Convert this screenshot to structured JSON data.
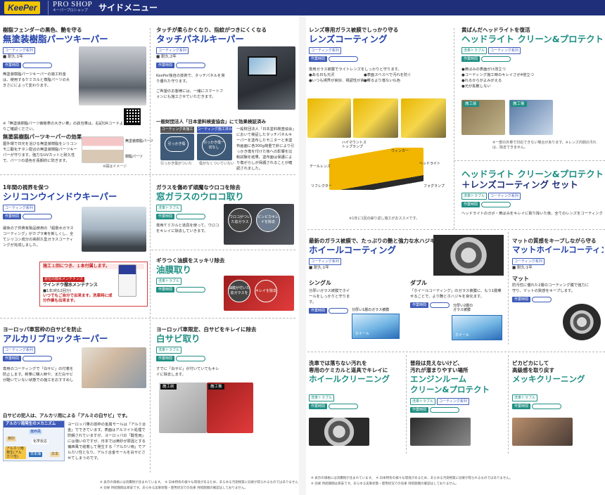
{
  "header": {
    "logo": "KeePer",
    "proshop": "PRO SHOP",
    "proshop_sub": "キーパープロショップ",
    "page_title": "サイドメニュー"
  },
  "items": {
    "unpainted": {
      "lead": "樹脂フェンダーの黒色、艶を守る",
      "title": "無塗装樹脂パーツキーパー",
      "tags": [
        "コーティング系列"
      ],
      "badge": "作業時間",
      "durability": "耐久:1年",
      "body": "無塗装樹脂パーツキーパーの施工料金は、使用するケミカルと樹脂パーツの大きさにによって変わります。",
      "qr_note": "※「無塗装樹脂パーツ価格表の大きい車」の該当車は、右記QRコードよりご確認ください。",
      "effect_head": "無塗装樹脂パーツキーパーの効果",
      "effect_body": "屋外環で日光を浴びる無塗装樹脂をシリコンモ二酸化チタン配合の無塗装樹脂パーツキーパーが守ります。強力なUVカットと耐久性で、パーツの退色を長期的に防ぎます。",
      "diagram_labels": [
        "無塗装樹脂パーツ",
        "樹脂パーツ"
      ],
      "image_note": "※図はイメージ"
    },
    "touchpanel": {
      "lead": "タッチが柔らかくなり、指紋がつきにくくなる",
      "title": "タッチパネルキーパー",
      "tags": [
        "コーティング系列"
      ],
      "badge": "作業時間",
      "durability": "耐久:2年",
      "body": "KeePer独自の技術で、タッチパネルを滑り優れた守ります。",
      "body2": "ご希望のお客様には、一緒にスマートフォンにも施工させていただきます。",
      "test_head": "一般財団法人「日本塗料検査協会」にて効果検証済み",
      "test_cols": [
        "コーティング未施工",
        "コーティング施工済み"
      ],
      "test_circles": [
        "引っかき傷",
        "引っかき傷一切なし"
      ],
      "test_captions": [
        "引っかき傷がついた",
        "傷がなくついていない"
      ],
      "test_body": "一般財団法人「日本塗料検査協会」において検証したタッチパネルキーパーを塗布したモニターと未塗布画面に各300g荷重で針により引っかき傷を付けた後への影響を比較試験を結果、塗布面は保護により傷がらしが保護されることが確認されました。"
    },
    "window": {
      "lead": "1年間の視界を保つ",
      "title": "シリコンウインドウキーパー",
      "tags": [
        "コーティング系列"
      ],
      "badge": "作業時間",
      "body": "最後の了供貴有製品使用の「超撥水ガラスコーティング」がカプラ東を新しくし、全てシリコン成分の高耐久型ガラスコーティングが完成しました。",
      "note_head": "施工１回につき、１本付属します。",
      "note_title": "窓位の撥水メンテナンス",
      "note_sub": "ウインドウ撥水メンテナンス",
      "note_qty": "■1本(約12回分)",
      "note_red": "いつでもご自分で出来ます。洗車時に成分作業も出来ます。"
    },
    "scale": {
      "lead": "ガラスを傷めず頑魔なウロコを除去",
      "title": "窓ガラスのウロコ取り",
      "tags": [
        "洗車トラブル"
      ],
      "badge": "作業時間",
      "body": "専用ケミカルと道具を使って、ウロコをキレイに除去していきます。",
      "circles": [
        "ウロコがついた窓ガラス",
        "ピンピカキレイを除去"
      ]
    },
    "oilfilm": {
      "lead": "ギラつく油膜をスッキリ除去",
      "title": "油膜取り",
      "tags": [
        "洗車トラブル"
      ],
      "badge": "作業時間",
      "circles": [
        "油膜が付いた窓ガラスを",
        "キレイを除去"
      ]
    },
    "alkali": {
      "lead": "ヨーロッパ車窓枠の白サビを防止",
      "title": "アルカリブロックキーパー",
      "tags": [
        "コーティング系列"
      ],
      "badge": "作業時間",
      "body": "専用のコーティングで「白サビ」の付着を防止します。新車に購入時や、まだ白サビが酷いていない状態での施工をおすすめします。",
      "culprit": "白サビの犯人は、アルカリ用による「アルミの白サビ」です。",
      "mech_title": "アルカリ雨発生のメカニズム",
      "mech_labels": [
        "偏西風",
        "黄砂",
        "化学反応",
        "日本海",
        "日本",
        "アルカリ雨発生(アルカリ性)"
      ],
      "mech_body": "ヨーロッパ車の窓枠の金属モールは「アルミ合金」でできています。表面はアルマイト処理で防錆されていますが、ヨーロッパの「酸性雨」には強いのですが、日本では黄砂が原因とする偏西風で結着して発生する「アルカリ雨」でアルカリ性となり、アルミ合金モールを白サビさせてしまうのです。"
    },
    "whiterust": {
      "lead": "ヨーロッパ車限定、白サビをキレイに除去",
      "title": "白サビ取り",
      "tags": [
        "洗車トラブル"
      ],
      "badge": "作業時間",
      "body": "すでに「白サビ」が付いていてもキレイに除去します。",
      "before": "施工前",
      "after": "施工後"
    },
    "lens": {
      "lead": "レンズ専用ガラス被膜でしっかり守る",
      "title": "レンズコーティング",
      "tags": [
        "コーティング系列"
      ],
      "badge": "作業時間",
      "body": "専用ガラス被膜でライトレンズをしっかりと守ります。",
      "bullets": [
        "●ある日も光沢",
        "●表面スベスベで汚れを防ぐ",
        "●いつも視界が良好、視認性が高い",
        "●寄るより落ない仏色"
      ],
      "callouts": [
        "ハイマウントストップランプ",
        "ウィンカー",
        "テールレンズ",
        "ヘッドライト",
        "リフレクター",
        "フォグランプ"
      ],
      "note": "※1年に1回の繰り返し施工がおススメです。"
    },
    "headlight": {
      "lead": "黄ばんだヘッドライトを復活",
      "title": "ヘッドライト クリーン&プロテクト",
      "tags": [
        "洗車トラブル",
        "コーティング系列"
      ],
      "badge": "作業時間",
      "bullets": [
        "●黄ばみの表面がけ改立つ",
        "●コーティング施工時のキレイさが4倍立つ",
        "●れるからがよみがえる",
        "●光が拡散しない"
      ],
      "before": "施工前",
      "after": "施工後",
      "notes": "※一部の外車で対応できない場合があります。※レンズ内側の汚れは、除去できません。"
    },
    "headlight_set": {
      "title_1": "ヘッドライト クリーン&プロテクト",
      "title_2": "＋レンズコーティング セット",
      "tags": [
        "洗車トラブル",
        "コーティング系列"
      ],
      "badge": "作業時間",
      "body": "ヘッドライトのガボ・黄ばみをキレイに取り除いた後、全てのレンズをコーティングします。"
    },
    "wheel": {
      "lead": "最新のガラス被膜で、たっぷりの艶と強力な水ハジキ",
      "title": "ホイールコーティング",
      "tags": [
        "コーティング系列"
      ],
      "badge": "作業時間",
      "durability": "耐久:1年",
      "single_head": "シングル",
      "single_body": "分厚いガラス被膜でホイールをしっかりと守ります。",
      "single_box": "分厚い1層のガラス被膜",
      "double_head": "ダブル",
      "double_body": "「ホイールコーティング」のガラス被膜に、もう1層乗せることで、より艶とホハジキを良化ます。",
      "double_box": "分厚い2層のガラス被膜",
      "box_label": "ホイール"
    },
    "matte_wheel": {
      "lead": "マットの質感をキープしながら守る",
      "title": "マットホイールコーティング",
      "tags": [
        "コーティング系列"
      ],
      "badge": "作業時間",
      "durability": "耐久:1年",
      "matte_head": "マット",
      "matte_body": "防汚性に優れた2層のコーティング膜で強力に守り、マットの質感をキープします。"
    },
    "wheel_clean": {
      "lead_1": "洗車では落ちない汚れを",
      "lead_2": "専用のケミカルと道具でキレイに",
      "title": "ホイールクリーニング",
      "tags": [
        "洗車トラブル"
      ],
      "badge": "作業時間"
    },
    "engine": {
      "lead_1": "普段は見えないけど、",
      "lead_2": "汚れが溜まりやすい場所",
      "title_1": "エンジンルーム",
      "title_2": "クリーン&プロテクト",
      "tags": [
        "洗車トラブル",
        "コーティング系列"
      ],
      "badge": "作業時間"
    },
    "chrome": {
      "lead_1": "ピカピカにして",
      "lead_2": "高級感を取り戻す",
      "title": "メッキクリーニング",
      "tags": [
        "洗車トラブル"
      ],
      "badge": "作業時間"
    }
  },
  "footnotes": {
    "left_1": "※ 表示の価格には消費税が含まれています。　※ 日本特有の様々な環境があるため、あらゆる汚染物質に効果が得られるものではありません",
    "left_2": "※ 効果 持続期間は目安です。あらゆる実車状態・使用状況での効果 持続期間の確認はしておりません。",
    "right_1": "※ 表示の価格には消費税が含まれています。　※ 日本特有の様々な環境があるため、あらゆる汚染物質に効果が得られるものではありません。",
    "right_2": "※ 効果 持続期間は目安です。あらゆる実車状態・使用状況での効果 持続期間の確認はしておりません。"
  }
}
